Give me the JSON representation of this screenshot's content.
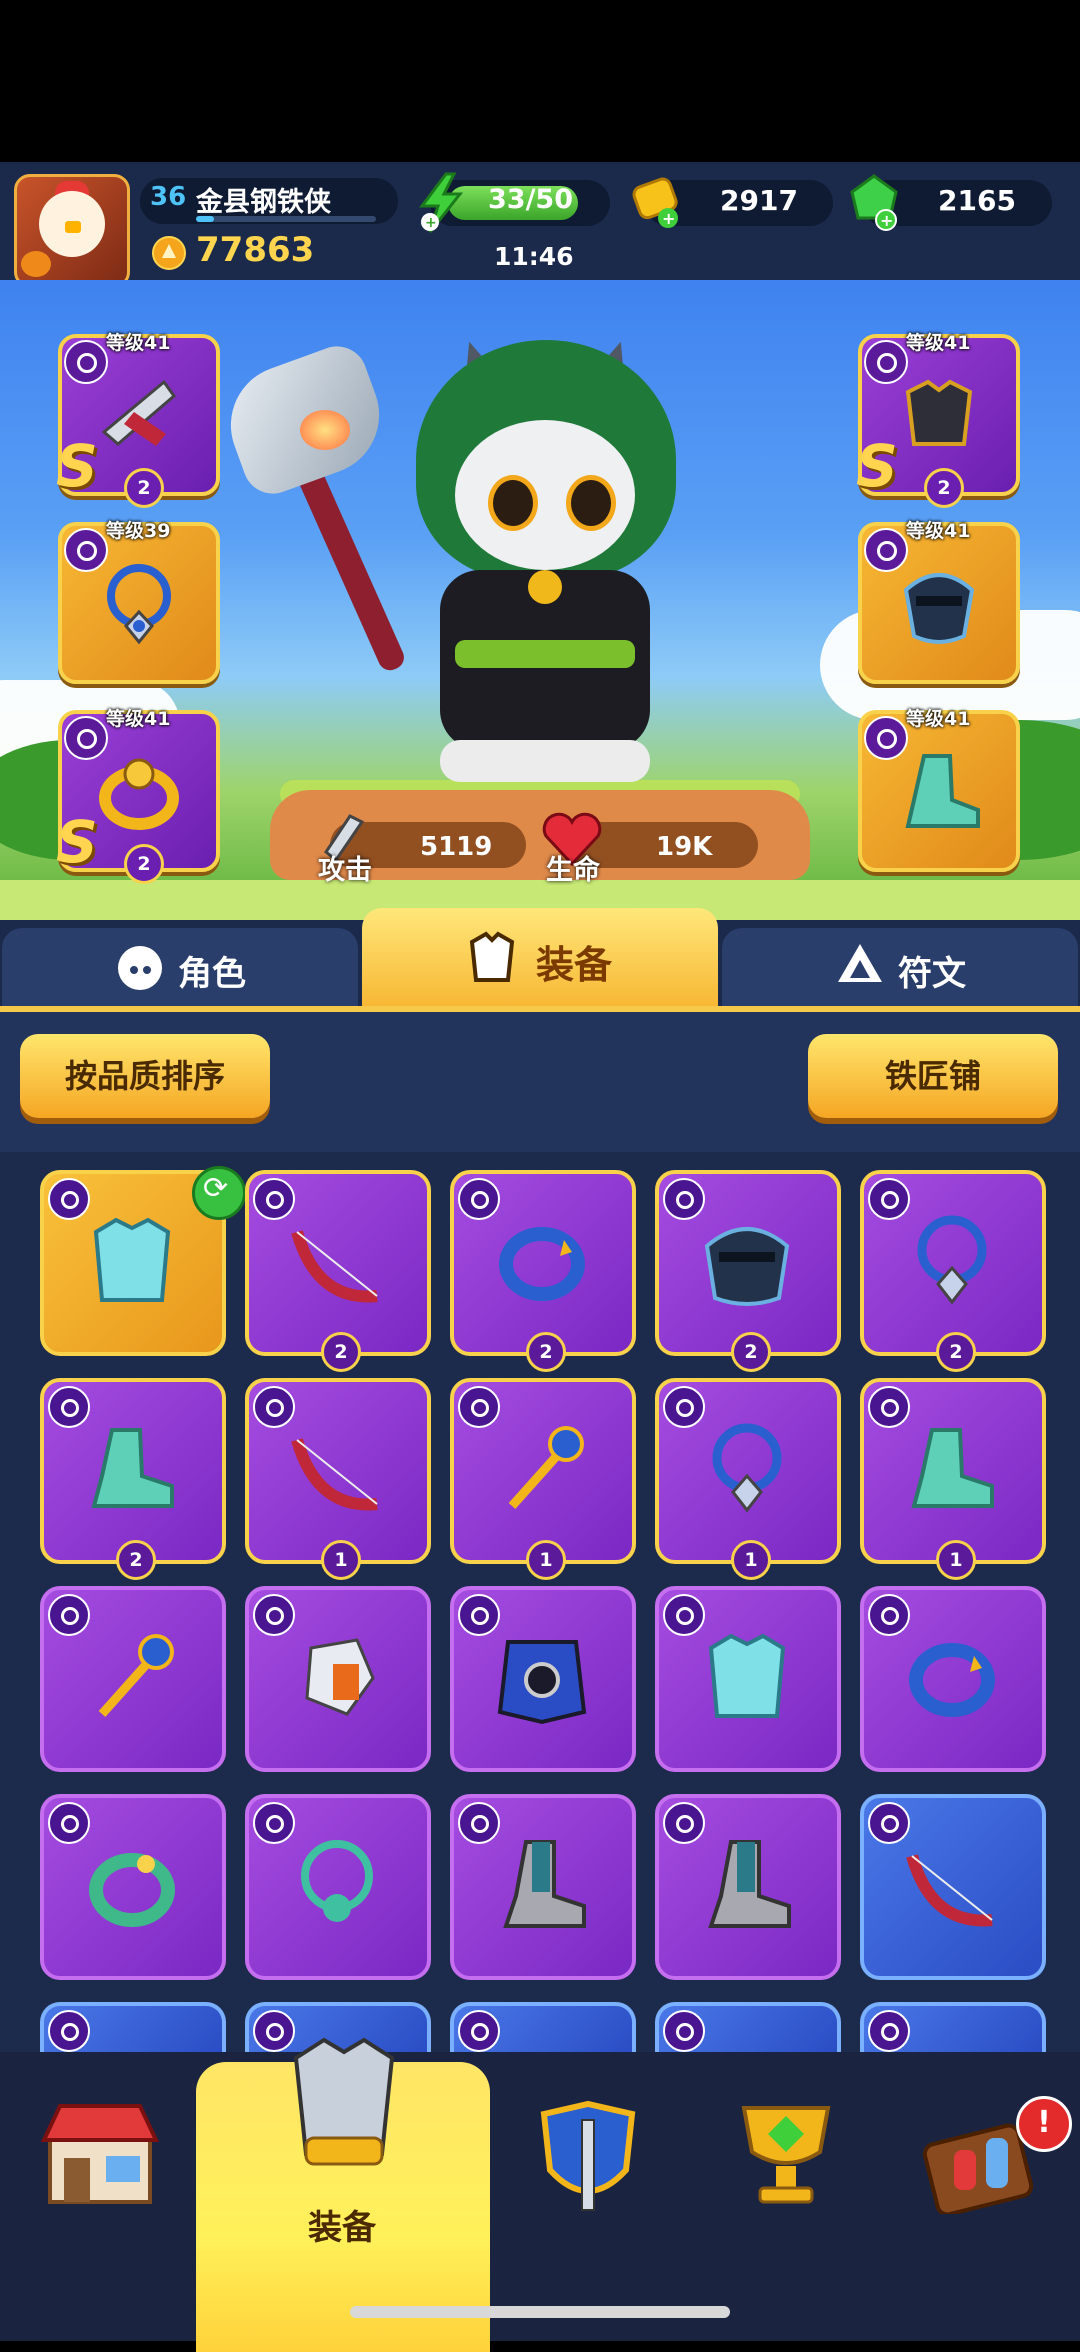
{
  "player": {
    "level": "36",
    "name": "金县钢铁侠",
    "trophies": "77863",
    "xp_progress": 0.1
  },
  "resources": {
    "energy": "33/50",
    "energy_timer": "11:46",
    "gold": "2917",
    "gems": "2165"
  },
  "equipped": {
    "left": [
      {
        "level_label": "等级41",
        "grade": "S",
        "count": "2",
        "type": "bow",
        "icon": "crossbow-icon"
      },
      {
        "level_label": "等级39",
        "grade": "",
        "count": "",
        "type": "necklace",
        "icon": "amulet-icon"
      },
      {
        "level_label": "等级41",
        "grade": "S",
        "count": "2",
        "type": "ring",
        "icon": "gold-ring-icon"
      }
    ],
    "right": [
      {
        "level_label": "等级41",
        "grade": "S",
        "count": "2",
        "type": "armor",
        "icon": "dark-armor-icon"
      },
      {
        "level_label": "等级41",
        "grade": "",
        "count": "",
        "type": "helmet",
        "icon": "mask-helmet-icon"
      },
      {
        "level_label": "等级41",
        "grade": "",
        "count": "",
        "type": "boots",
        "icon": "teal-boots-icon"
      }
    ]
  },
  "stats": {
    "attack_label": "攻击",
    "attack_value": "5119",
    "hp_label": "生命",
    "hp_value": "19K"
  },
  "tabs": [
    {
      "label": "角色",
      "icon": "character-icon",
      "active": false
    },
    {
      "label": "装备",
      "icon": "armor-icon",
      "active": true
    },
    {
      "label": "符文",
      "icon": "rune-icon",
      "active": false
    }
  ],
  "buttons": {
    "sort": "按品质排序",
    "blacksmith": "铁匠铺"
  },
  "inventory": [
    {
      "rarity": "legend",
      "icon": "teal-armor-icon",
      "count": "",
      "upgrade": true
    },
    {
      "rarity": "epicg",
      "icon": "red-bow-icon",
      "count": "2"
    },
    {
      "rarity": "epicg",
      "icon": "blue-ring-icon",
      "count": "2"
    },
    {
      "rarity": "epicg",
      "icon": "mask-helmet-icon",
      "count": "2"
    },
    {
      "rarity": "epicg",
      "icon": "amulet-icon",
      "count": "2"
    },
    {
      "rarity": "epicg",
      "icon": "teal-boots-icon",
      "count": "2"
    },
    {
      "rarity": "epicg",
      "icon": "red-bow-icon",
      "count": "1"
    },
    {
      "rarity": "epicg",
      "icon": "blue-staff-icon",
      "count": "1"
    },
    {
      "rarity": "epicg",
      "icon": "amulet-icon",
      "count": "1"
    },
    {
      "rarity": "epicg",
      "icon": "teal-boots-icon",
      "count": "1"
    },
    {
      "rarity": "epic",
      "icon": "blue-staff-icon",
      "count": ""
    },
    {
      "rarity": "epic",
      "icon": "spiked-gauntlet-icon",
      "count": ""
    },
    {
      "rarity": "epic",
      "icon": "dark-cape-icon",
      "count": ""
    },
    {
      "rarity": "epic",
      "icon": "teal-armor-icon",
      "count": ""
    },
    {
      "rarity": "epic",
      "icon": "blue-ring-icon",
      "count": ""
    },
    {
      "rarity": "epic",
      "icon": "green-ring-icon",
      "count": ""
    },
    {
      "rarity": "epic",
      "icon": "octopus-amulet-icon",
      "count": ""
    },
    {
      "rarity": "epic",
      "icon": "grey-boots-icon",
      "count": ""
    },
    {
      "rarity": "epic",
      "icon": "grey-boots-icon",
      "count": ""
    },
    {
      "rarity": "rare",
      "icon": "red-bow-icon",
      "count": ""
    }
  ],
  "nav": [
    {
      "icon": "shop-icon",
      "label": ""
    },
    {
      "icon": "armor-icon",
      "label": "装备",
      "active": true
    },
    {
      "icon": "shield-sword-icon",
      "label": ""
    },
    {
      "icon": "trophy-cup-icon",
      "label": ""
    },
    {
      "icon": "workshop-icon",
      "label": "",
      "badge": "!"
    }
  ],
  "colors": {
    "legend": "#f9c13a",
    "epic": "#a54ce0",
    "rare": "#4a78e8",
    "accent": "#f7d24a"
  }
}
